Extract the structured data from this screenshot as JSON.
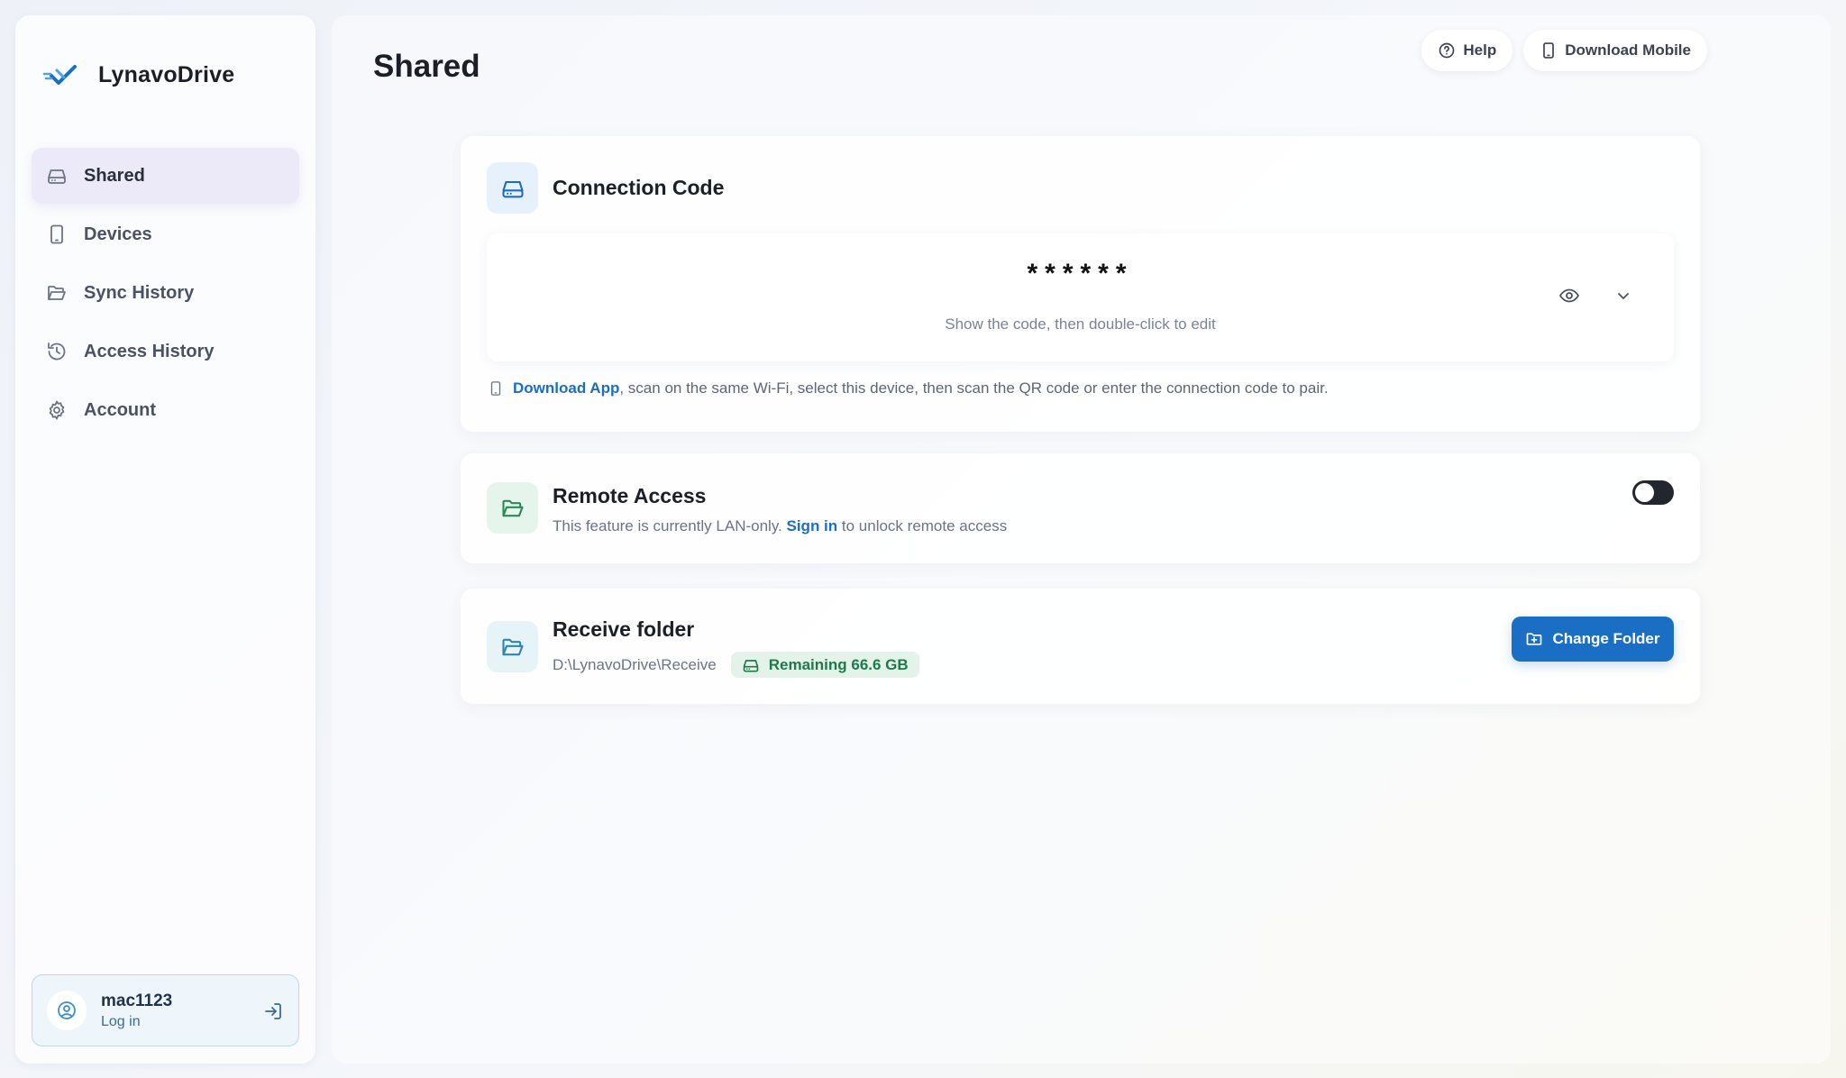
{
  "app": {
    "brand_name": "LynavoDrive",
    "accent_color": "#1a6fc4"
  },
  "sidebar": {
    "items": [
      {
        "label": "Shared",
        "icon": "drive-icon",
        "active": true
      },
      {
        "label": "Devices",
        "icon": "phone-icon",
        "active": false
      },
      {
        "label": "Sync History",
        "icon": "folder-open-icon",
        "active": false
      },
      {
        "label": "Access History",
        "icon": "history-icon",
        "active": false
      },
      {
        "label": "Account",
        "icon": "gear-icon",
        "active": false
      }
    ],
    "user": {
      "name": "mac1123",
      "action_label": "Log in"
    }
  },
  "header": {
    "title": "Shared",
    "help_label": "Help",
    "download_mobile_label": "Download Mobile"
  },
  "connection": {
    "title": "Connection Code",
    "code_masked": "******",
    "hint": "Show the code, then double-click to edit",
    "note_link": "Download App",
    "note_text": ", scan on the same Wi-Fi, select this device, then scan the QR code or enter the connection code to pair."
  },
  "remote": {
    "title": "Remote Access",
    "subtitle_prefix": "This feature is currently LAN-only. ",
    "sign_in_link": "Sign in",
    "subtitle_suffix": " to unlock remote access",
    "enabled": false
  },
  "receive": {
    "title": "Receive folder",
    "path": "D:\\LynavoDrive\\Receive",
    "remaining_label": "Remaining 66.6 GB",
    "change_button_label": "Change Folder"
  }
}
